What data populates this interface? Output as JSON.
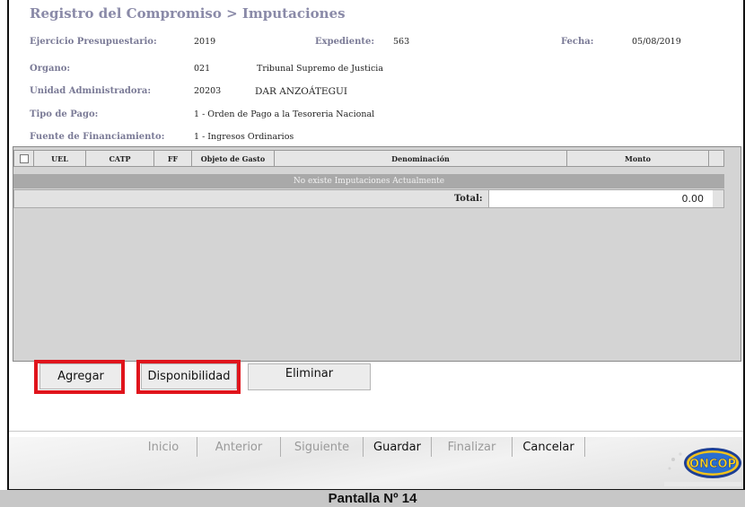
{
  "header": {
    "title": "Registro del Compromiso > Imputaciones"
  },
  "form": {
    "ejercicio_label": "Ejercicio Presupuestario:",
    "ejercicio_value": "2019",
    "expediente_label": "Expediente:",
    "expediente_value": "563",
    "fecha_label": "Fecha:",
    "fecha_value": "05/08/2019",
    "organo_label": "Organo:",
    "organo_code": "021",
    "organo_name": "Tribunal Supremo de Justicia",
    "unidad_label": "Unidad Administradora:",
    "unidad_code": "20203",
    "unidad_name": "DAR ANZOÁTEGUI",
    "tipo_label": "Tipo de Pago:",
    "tipo_value": "1 - Orden de Pago a la Tesoreria Nacional",
    "fuente_label": "Fuente de Financiamiento:",
    "fuente_value": "1 - Ingresos Ordinarios"
  },
  "table": {
    "columns": [
      "UEL",
      "CATP",
      "FF",
      "Objeto de Gasto",
      "Denominación",
      "Monto"
    ],
    "empty_message": "No existe Imputaciones Actualmente",
    "total_label": "Total:",
    "total_value": "0.00"
  },
  "actions": {
    "agregar": "Agregar",
    "disponibilidad": "Disponibilidad",
    "eliminar": "Eliminar",
    "highlight_color": "#e0141c"
  },
  "nav": {
    "inicio": "Inicio",
    "anterior": "Anterior",
    "siguiente": "Siguiente",
    "guardar": "Guardar",
    "finalizar": "Finalizar",
    "cancelar": "Cancelar"
  },
  "logo": {
    "name": "ONCOP"
  },
  "caption": "Pantalla Nº 14"
}
